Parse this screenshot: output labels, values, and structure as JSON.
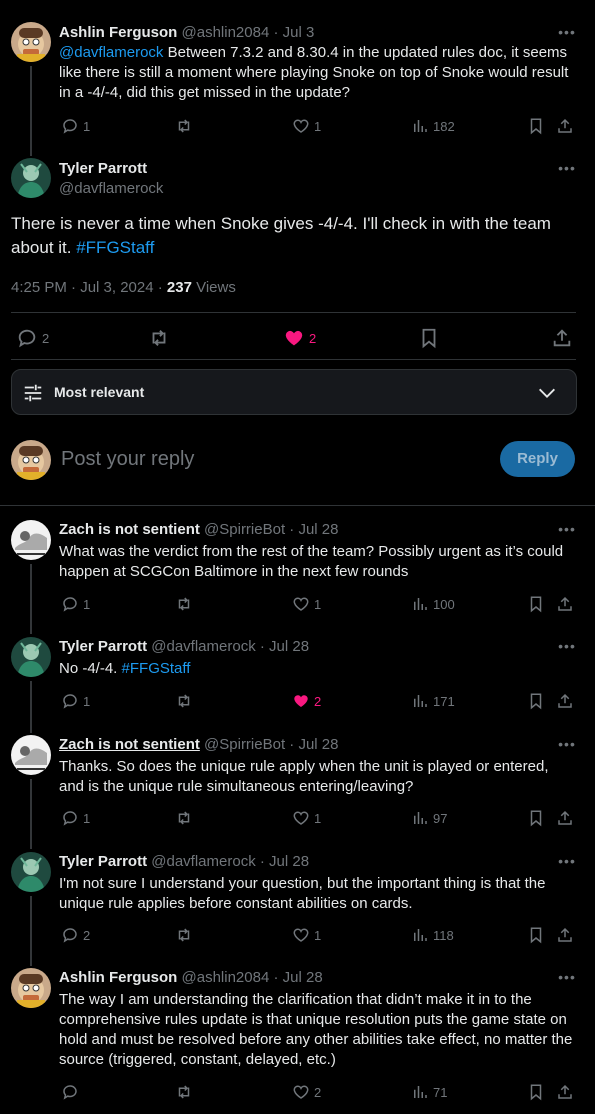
{
  "parent": {
    "name": "Ashlin Ferguson",
    "handle": "@ashlin2084",
    "sep": "·",
    "date": "Jul 3",
    "mention": "@davflamerock",
    "text": " Between 7.3.2 and 8.30.4 in the updated rules doc, it seems like there is still a moment where playing Snoke on top of Snoke would result in a -4/-4, did this get missed in the update?",
    "replies": "1",
    "reposts": "",
    "likes": "1",
    "views": "182"
  },
  "main": {
    "name": "Tyler Parrott",
    "handle": "@davflamerock",
    "text": "There is never a time when Snoke gives -4/-4. I'll check in with the team about it. ",
    "hashtag": "#FFGStaff",
    "time": "4:25 PM · Jul 3, 2024 · ",
    "views_count": "237",
    "views_label": " Views",
    "replies": "2",
    "likes": "2"
  },
  "sort": {
    "label": "Most relevant"
  },
  "compose": {
    "placeholder": "Post your reply",
    "button": "Reply"
  },
  "replies": [
    {
      "name": "Zach is not sentient",
      "handle": "@SpirrieBot",
      "sep": "·",
      "date": "Jul 28",
      "text": "What was the verdict from the rest of the team? Possibly urgent as it’s could happen at SCGCon Baltimore in the next few rounds",
      "replies": "1",
      "likes": "1",
      "views": "100"
    },
    {
      "name": "Tyler Parrott",
      "handle": "@davflamerock",
      "sep": "·",
      "date": "Jul 28",
      "text": "No -4/-4. ",
      "hashtag": "#FFGStaff",
      "replies": "1",
      "likes": "2",
      "views": "171"
    },
    {
      "name": "Zach is not sentient",
      "handle": "@SpirrieBot",
      "sep": "·",
      "date": "Jul 28",
      "text": "Thanks. So does the unique rule apply when the unit is played or entered, and is the unique rule simultaneous entering/leaving?",
      "replies": "1",
      "likes": "1",
      "views": "97"
    },
    {
      "name": "Tyler Parrott",
      "handle": "@davflamerock",
      "sep": "·",
      "date": "Jul 28",
      "text": "I'm not sure I understand your question, but the important thing is that the unique rule applies before constant abilities on cards.",
      "replies": "2",
      "likes": "1",
      "views": "118"
    },
    {
      "name": "Ashlin Ferguson",
      "handle": "@ashlin2084",
      "sep": "·",
      "date": "Jul 28",
      "text": "The way I am understanding the clarification that didn’t make it in to the comprehensive rules update is that unique resolution puts the game state on hold and must be resolved before any other abilities take effect, no matter the source (triggered, constant, delayed, etc.)",
      "replies": "",
      "likes": "2",
      "views": "71"
    }
  ],
  "colors": {
    "accent": "#1d9bf0",
    "like": "#f91880",
    "muted": "#71767b",
    "text": "#e7e9ea",
    "border": "#2f3336"
  }
}
